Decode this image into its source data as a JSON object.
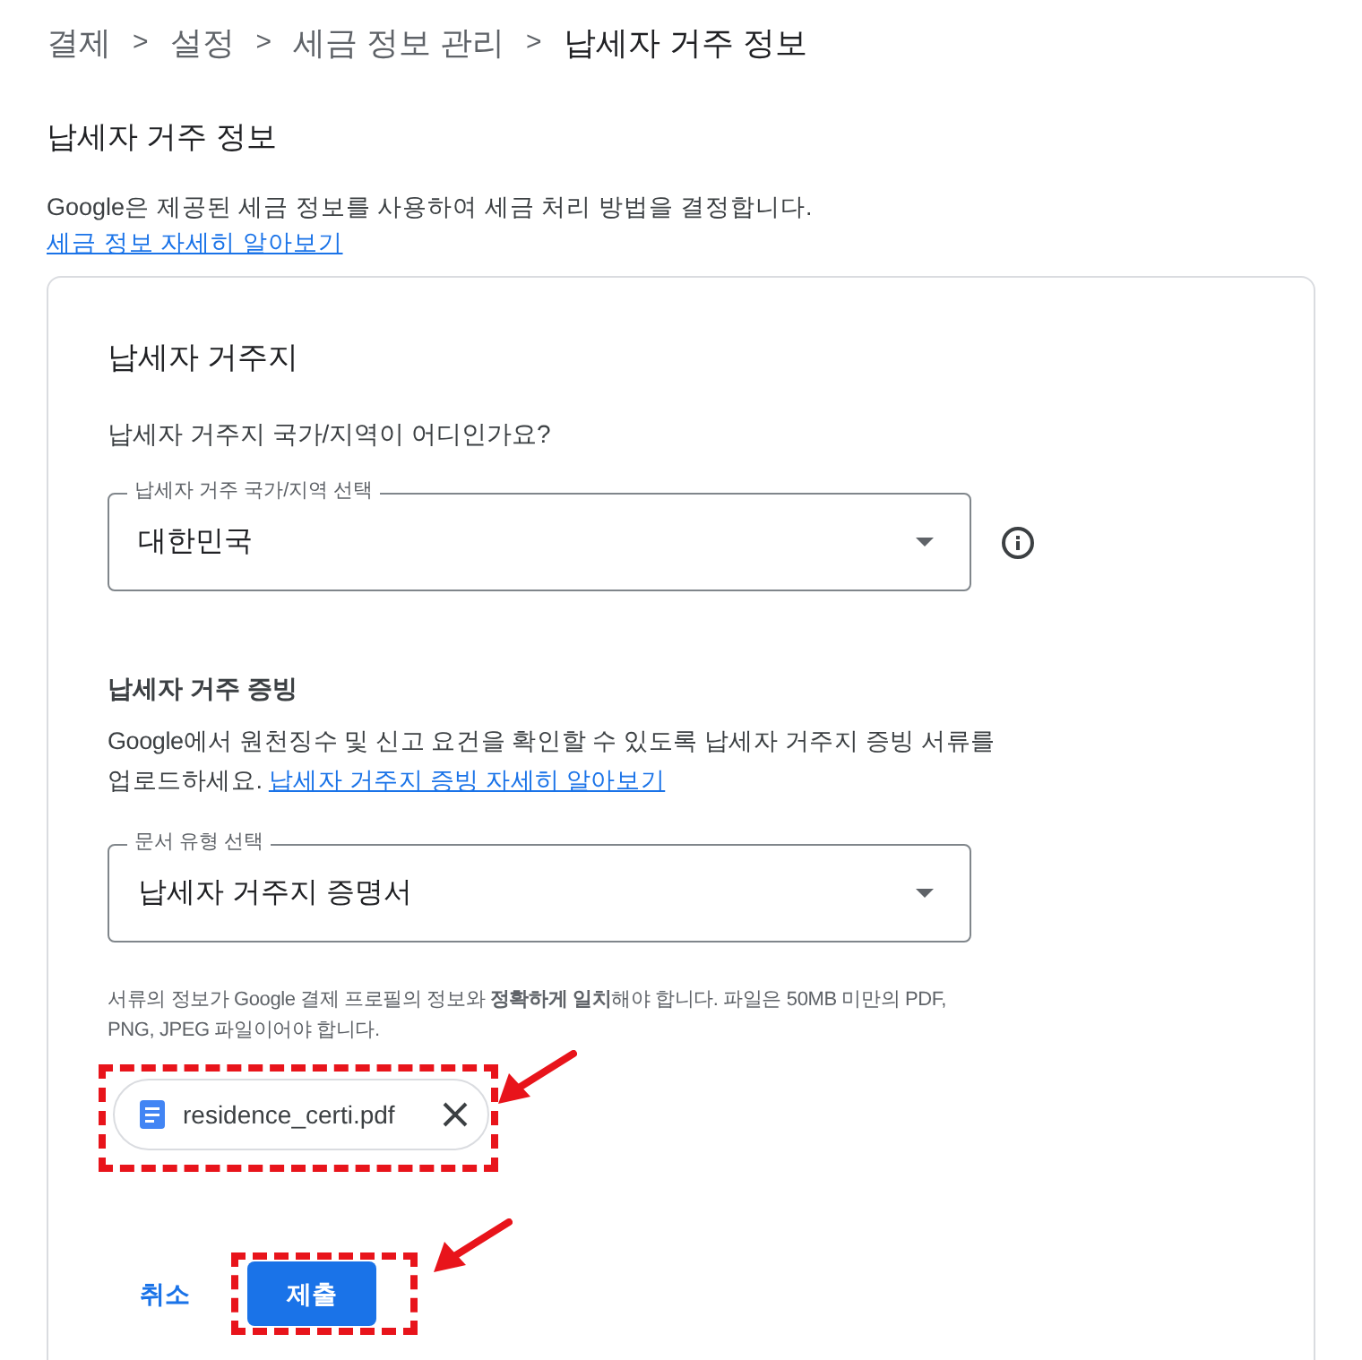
{
  "breadcrumb": [
    {
      "label": "결제",
      "current": false
    },
    {
      "label": "설정",
      "current": false
    },
    {
      "label": "세금 정보 관리",
      "current": false
    },
    {
      "label": "납세자 거주 정보",
      "current": true
    }
  ],
  "breadcrumb_separator": ">",
  "page_title": "납세자 거주 정보",
  "description": {
    "text": "Google은 제공된 세금 정보를 사용하여 세금 처리 방법을 결정합니다.",
    "link": "세금 정보 자세히 알아보기"
  },
  "card": {
    "title": "납세자 거주지",
    "question": "납세자 거주지 국가/지역이 어디인가요?",
    "residence_select": {
      "label": "납세자 거주 국가/지역 선택",
      "value": "대한민국"
    },
    "proof_heading": "납세자 거주 증빙",
    "proof_text": "Google에서 원천징수 및 신고 요건을 확인할 수 있도록 납세자 거주지 증빙 서류를 업로드하세요.",
    "proof_link": "납세자 거주지 증빙 자세히 알아보기",
    "document_select": {
      "label": "문서 유형 선택",
      "value": "납세자 거주지 증명서"
    },
    "note": "서류의 정보가 Google 결제 프로필의 정보와 **정확하게 일치**해야 합니다. 파일은 50MB 미만의 PDF, PNG, JPEG 파일이어야 합니다.",
    "file": {
      "name": "residence_certi.pdf"
    },
    "cancel_button": "취소",
    "submit_button": "제출"
  }
}
